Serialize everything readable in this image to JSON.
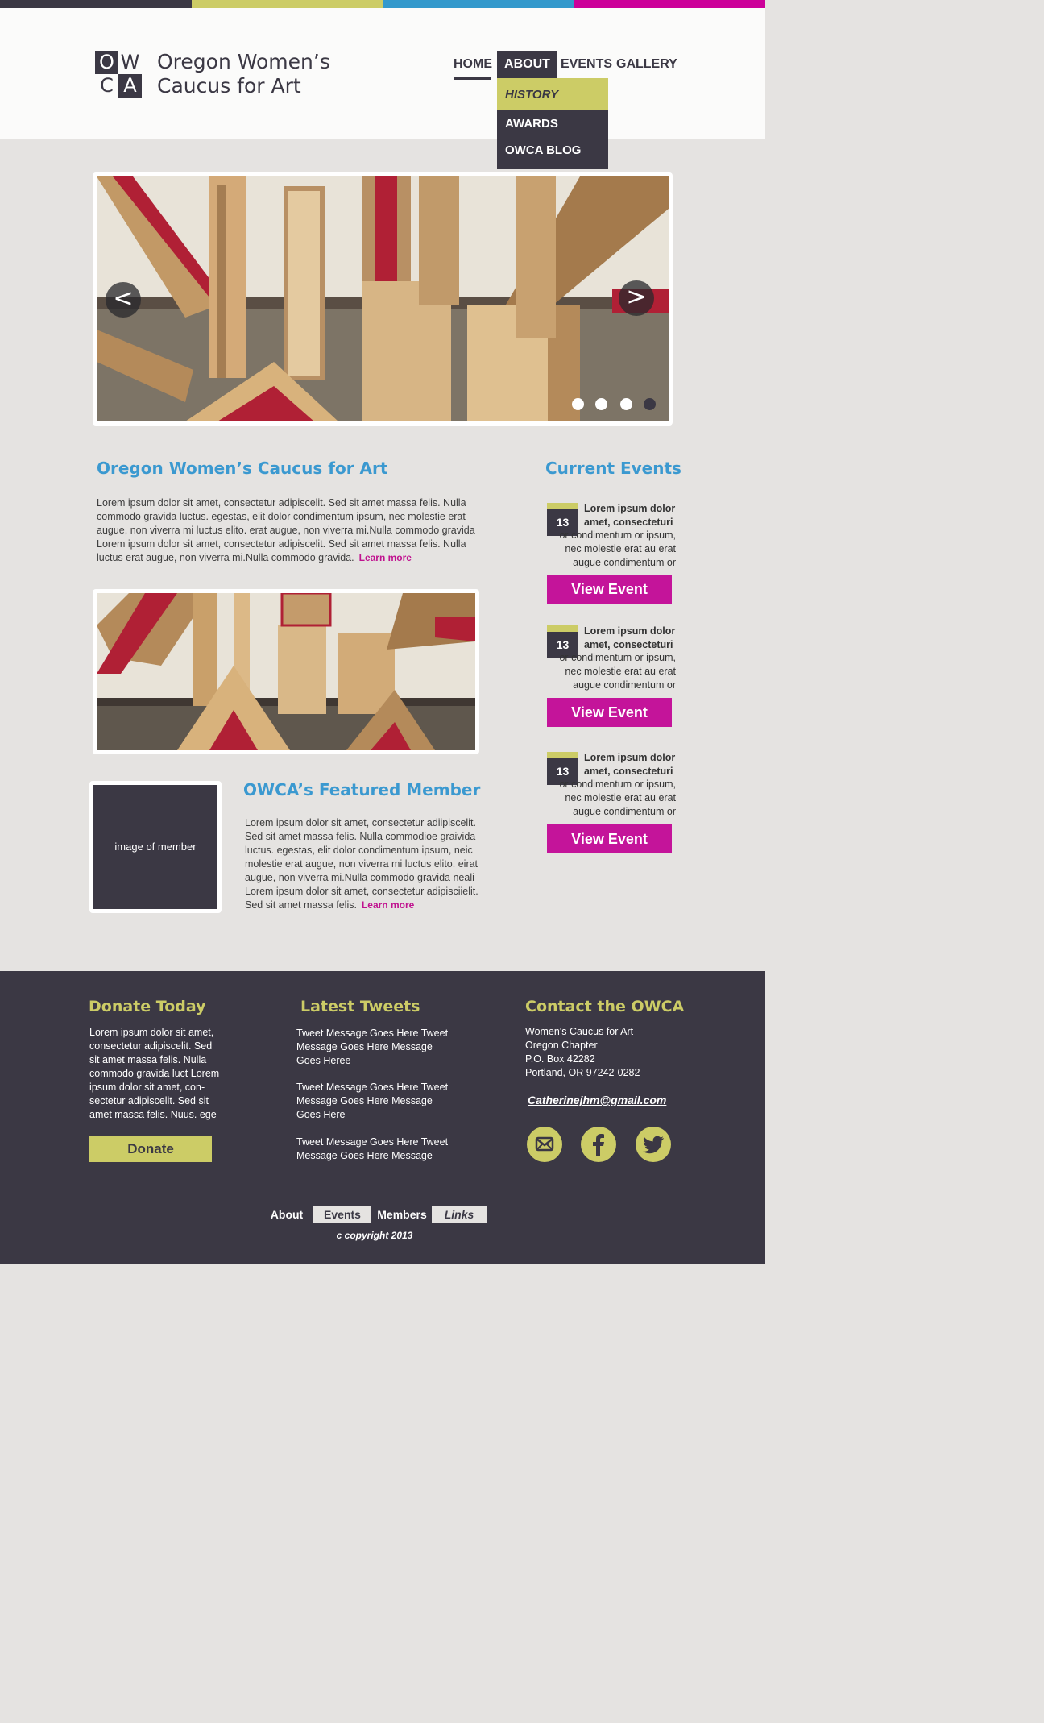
{
  "colors": {
    "dark": "#3b3844",
    "lime": "#cccc66",
    "blue": "#3399cc",
    "magenta": "#c4149a",
    "topbar": [
      "#3b3844",
      "#cccc66",
      "#3399cc",
      "#cc0099"
    ]
  },
  "logo": {
    "letters": [
      "O",
      "W",
      "C",
      "A"
    ]
  },
  "site": {
    "title": "Oregon Women’s Caucus for Art"
  },
  "nav": {
    "items": [
      "HOME",
      "ABOUT",
      "EVENTS",
      "GALLERY"
    ],
    "dropdown": [
      "HISTORY",
      "AWARDS",
      "OWCA BLOG"
    ]
  },
  "slider": {
    "prev": "<",
    "next": ">",
    "slide_count": 4,
    "active_slide": 4
  },
  "about": {
    "title": "Oregon Women’s Caucus for Art",
    "text": "Lorem ipsum dolor sit amet, consectetur adipiscelit. Sed sit amet massa felis. Nulla commodo gravida luctus. egestas, elit dolor condimentum ipsum, nec molestie erat augue, non viverra mi luctus elito. erat augue, non viverra mi.Nulla commodo gravida Lorem ipsum dolor sit amet, consectetur adipiscelit. Sed sit amet massa felis. Nulla luctus erat augue, non viverra mi.Nulla commodo gravida.",
    "learn_more": "Learn more"
  },
  "featured": {
    "title": "OWCA’s Featured Member",
    "image_label": "image of member",
    "text": "Lorem ipsum dolor sit amet, consectetur adiipiscelit. Sed sit amet massa felis. Nulla commodioe graivida luctus. egestas, elit dolor condimentum ipsum, neic molestie erat augue, non viverra mi luctus elito. eirat augue, non viverra mi.Nulla commodo gravida neali Lorem ipsum dolor sit amet, consectetur adipisciielit. Sed sit amet massa felis.",
    "learn_more": "Learn more"
  },
  "events": {
    "title": "Current Events",
    "items": [
      {
        "day": "13",
        "bold": "Lorem ipsum dolor amet, consecteturi",
        "text": "or condimentum or ipsum, nec molestie erat au erat augue condimentum or",
        "button": "View Event"
      },
      {
        "day": "13",
        "bold": "Lorem ipsum dolor amet, consecteturi",
        "text": "or condimentum or ipsum, nec molestie erat au erat augue condimentum or",
        "button": "View Event"
      },
      {
        "day": "13",
        "bold": "Lorem ipsum dolor amet, consecteturi",
        "text": "or condimentum or ipsum, nec molestie erat au erat augue condimentum or",
        "button": "View Event"
      }
    ]
  },
  "footer": {
    "donate": {
      "title": "Donate Today",
      "text": "Lorem ipsum dolor sit amet, consectetur adipiscelit. Sed sit amet massa felis. Nulla commodo gravida luct Lorem ipsum dolor sit amet, con-sectetur adipiscelit. Sed sit amet massa felis. Nuus. ege",
      "button": "Donate"
    },
    "tweets": {
      "title": "Latest Tweets",
      "items": [
        "Tweet Message Goes Here Tweet Message Goes Here Message Goes Heree",
        "Tweet Message Goes Here Tweet Message Goes Here Message Goes Here",
        "Tweet Message Goes Here Tweet Message Goes Here Message"
      ]
    },
    "contact": {
      "title": "Contact the OWCA",
      "lines": [
        "Women's Caucus for Art",
        "Oregon Chapter",
        "P.O. Box 42282",
        "Portland, OR 97242-0282"
      ],
      "email": "Catherinejhm@gmail.com",
      "social_icons": [
        "email-icon",
        "facebook-icon",
        "twitter-icon"
      ]
    },
    "bottom_nav": [
      "About",
      "Events",
      "Members",
      "Links"
    ],
    "copyright": "c copyright 2013"
  }
}
